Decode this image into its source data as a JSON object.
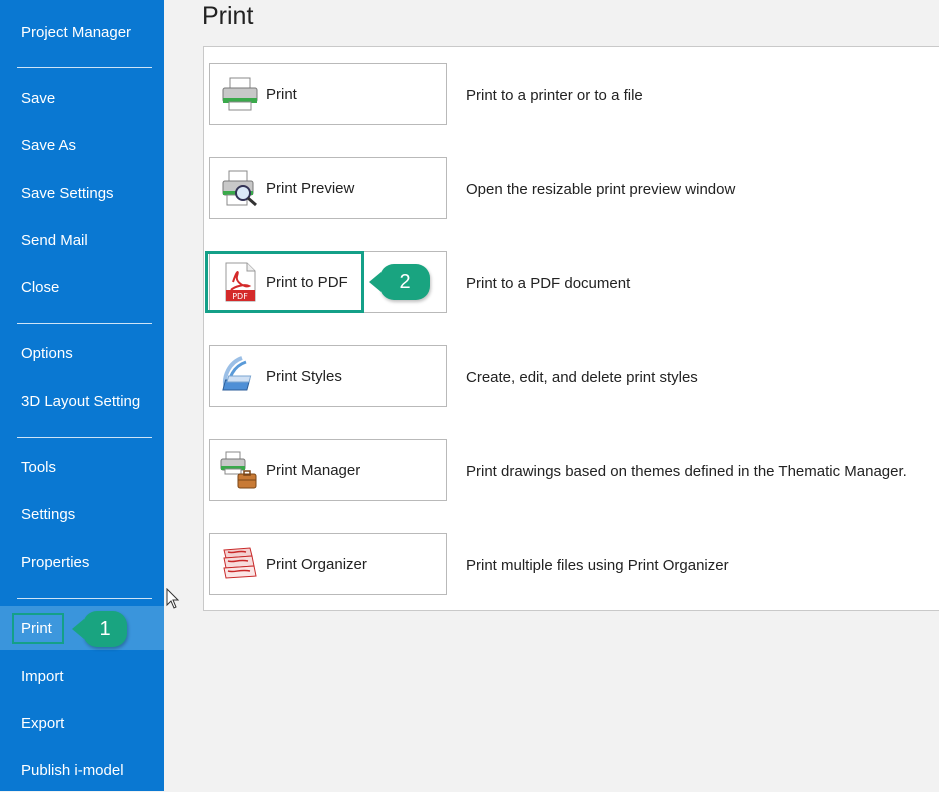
{
  "sidebar": {
    "items": [
      {
        "label": "Project Manager"
      },
      {
        "label": "Save"
      },
      {
        "label": "Save As"
      },
      {
        "label": "Save Settings"
      },
      {
        "label": "Send Mail"
      },
      {
        "label": "Close"
      },
      {
        "label": "Options"
      },
      {
        "label": "3D Layout Setting"
      },
      {
        "label": "Tools"
      },
      {
        "label": "Settings"
      },
      {
        "label": "Properties"
      },
      {
        "label": "Print"
      },
      {
        "label": "Import"
      },
      {
        "label": "Export"
      },
      {
        "label": "Publish i-model"
      }
    ],
    "active": "Print"
  },
  "main": {
    "title": "Print",
    "commands": [
      {
        "label": "Print",
        "description": "Print to a printer or to a file",
        "icon": "printer-icon"
      },
      {
        "label": "Print Preview",
        "description": "Open the resizable print preview window",
        "icon": "print-preview-icon"
      },
      {
        "label": "Print to PDF",
        "description": "Print to a PDF document",
        "icon": "pdf-icon",
        "icon_text": "PDF"
      },
      {
        "label": "Print Styles",
        "description": "Create, edit, and delete print styles",
        "icon": "print-styles-icon"
      },
      {
        "label": "Print Manager",
        "description": "Print drawings based on themes defined in the Thematic Manager.",
        "icon": "print-manager-icon"
      },
      {
        "label": "Print Organizer",
        "description": "Print multiple files using Print Organizer",
        "icon": "print-organizer-icon"
      }
    ]
  },
  "callouts": [
    "1",
    "2"
  ],
  "colors": {
    "sidebar": "#0a78d2",
    "sidebar_active": "#3a95dc",
    "callout": "#19a480",
    "highlight_border": "#14a088"
  }
}
